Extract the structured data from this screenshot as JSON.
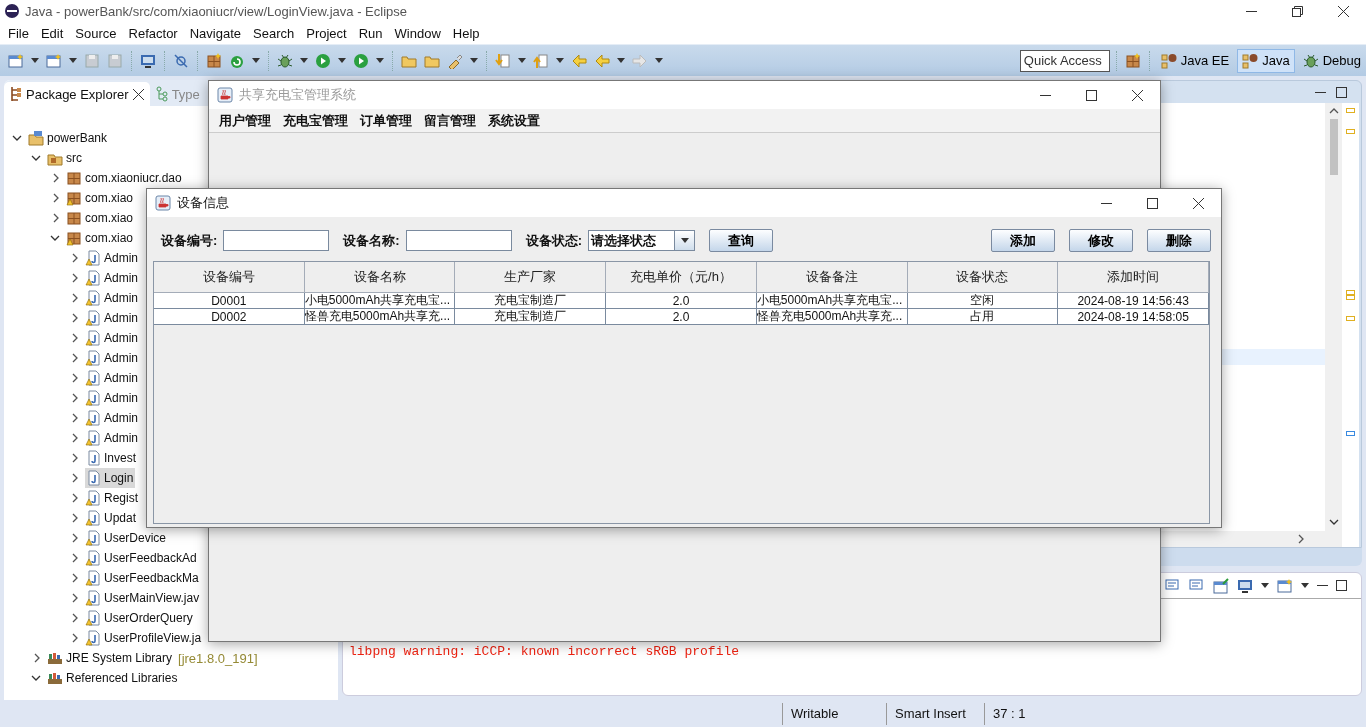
{
  "eclipse": {
    "title": "Java - powerBank/src/com/xiaoniucr/view/LoginView.java - Eclipse",
    "menus": [
      "File",
      "Edit",
      "Source",
      "Refactor",
      "Navigate",
      "Search",
      "Project",
      "Run",
      "Window",
      "Help"
    ],
    "quick_access": {
      "placeholder": "Quick Access"
    },
    "perspectives": [
      {
        "label": "Java EE",
        "kind": "javaee",
        "selected": false
      },
      {
        "label": "Java",
        "kind": "java",
        "selected": true
      },
      {
        "label": "Debug",
        "kind": "debug",
        "selected": false
      }
    ],
    "explorer": {
      "tabs": [
        {
          "label": "Package Explorer",
          "kind": "packages",
          "selected": true
        },
        {
          "label": "Type",
          "kind": "hierarchy",
          "selected": false
        }
      ],
      "tree": [
        {
          "label": "powerBank",
          "kind": "project",
          "expanded": true,
          "selected": false,
          "children": [
            {
              "label": "src",
              "kind": "source-folder",
              "expanded": true,
              "selected": false,
              "children": [
                {
                  "label": "com.xiaoniucr.dao",
                  "kind": "package",
                  "expanded": false,
                  "selected": false
                },
                {
                  "label": "com.xiao",
                  "kind": "package-warn",
                  "expanded": false,
                  "selected": false
                },
                {
                  "label": "com.xiao",
                  "kind": "package",
                  "expanded": false,
                  "selected": false
                },
                {
                  "label": "com.xiao",
                  "kind": "package-warn",
                  "expanded": true,
                  "selected": false,
                  "children": [
                    {
                      "label": "Admin",
                      "kind": "java-warn",
                      "expanded": false,
                      "selected": false
                    },
                    {
                      "label": "Admin",
                      "kind": "java-warn",
                      "expanded": false,
                      "selected": false
                    },
                    {
                      "label": "Admin",
                      "kind": "java-warn",
                      "expanded": false,
                      "selected": false
                    },
                    {
                      "label": "Admin",
                      "kind": "java-warn",
                      "expanded": false,
                      "selected": false
                    },
                    {
                      "label": "Admin",
                      "kind": "java-warn",
                      "expanded": false,
                      "selected": false
                    },
                    {
                      "label": "Admin",
                      "kind": "java-warn",
                      "expanded": false,
                      "selected": false
                    },
                    {
                      "label": "Admin",
                      "kind": "java-warn",
                      "expanded": false,
                      "selected": false
                    },
                    {
                      "label": "Admin",
                      "kind": "java-warn",
                      "expanded": false,
                      "selected": false
                    },
                    {
                      "label": "Admin",
                      "kind": "java-warn",
                      "expanded": false,
                      "selected": false
                    },
                    {
                      "label": "Admin",
                      "kind": "java-warn",
                      "expanded": false,
                      "selected": false
                    },
                    {
                      "label": "Invest",
                      "kind": "java",
                      "expanded": false,
                      "selected": false
                    },
                    {
                      "label": "Login",
                      "kind": "java",
                      "expanded": false,
                      "selected": true
                    },
                    {
                      "label": "Regist",
                      "kind": "java-warn",
                      "expanded": false,
                      "selected": false
                    },
                    {
                      "label": "Updat",
                      "kind": "java-warn",
                      "expanded": false,
                      "selected": false
                    },
                    {
                      "label": "UserDevice",
                      "kind": "java-warn",
                      "expanded": false,
                      "selected": false
                    },
                    {
                      "label": "UserFeedbackAd",
                      "kind": "java-warn",
                      "expanded": false,
                      "selected": false
                    },
                    {
                      "label": "UserFeedbackMa",
                      "kind": "java-warn",
                      "expanded": false,
                      "selected": false
                    },
                    {
                      "label": "UserMainView.jav",
                      "kind": "java-warn",
                      "expanded": false,
                      "selected": false
                    },
                    {
                      "label": "UserOrderQuery",
                      "kind": "java-warn",
                      "expanded": false,
                      "selected": false
                    },
                    {
                      "label": "UserProfileView.ja",
                      "kind": "java-warn",
                      "expanded": false,
                      "selected": false
                    }
                  ]
                }
              ]
            },
            {
              "label": "JRE System Library",
              "suffix": "[jre1.8.0_191]",
              "kind": "library",
              "expanded": false,
              "selected": false
            },
            {
              "label": "Referenced Libraries",
              "kind": "library",
              "expanded": true,
              "selected": false
            }
          ]
        }
      ]
    },
    "console": {
      "lines": [
        "libpng warning: iCCP: known incorrect sRGB profile"
      ]
    },
    "status_bar": [
      "Writable",
      "Smart Insert",
      "37 : 1"
    ]
  },
  "main_window": {
    "title": "共享充电宝管理系统",
    "menus": [
      "用户管理",
      "充电宝管理",
      "订单管理",
      "留言管理",
      "系统设置"
    ]
  },
  "dialog": {
    "title": "设备信息",
    "filters": [
      {
        "label": "设备编号:",
        "kind": "text"
      },
      {
        "label": "设备名称:",
        "kind": "text"
      },
      {
        "label": "设备状态:",
        "kind": "select",
        "value": "请选择状态"
      }
    ],
    "search_button": "查询",
    "actions": [
      "添加",
      "修改",
      "删除"
    ],
    "table": {
      "columns": [
        "设备编号",
        "设备名称",
        "生产厂家",
        "充电单价（元/h）",
        "设备备注",
        "设备状态",
        "添加时间"
      ],
      "rows": [
        [
          "D0001",
          "小电5000mAh共享充电宝...",
          "充电宝制造厂",
          "2.0",
          "小电5000mAh共享充电宝...",
          "空闲",
          "2024-08-19 14:56:43"
        ],
        [
          "D0002",
          "怪兽充电5000mAh共享充...",
          "充电宝制造厂",
          "2.0",
          "怪兽充电5000mAh共享充...",
          "占用",
          "2024-08-19 14:58:05"
        ]
      ]
    }
  }
}
